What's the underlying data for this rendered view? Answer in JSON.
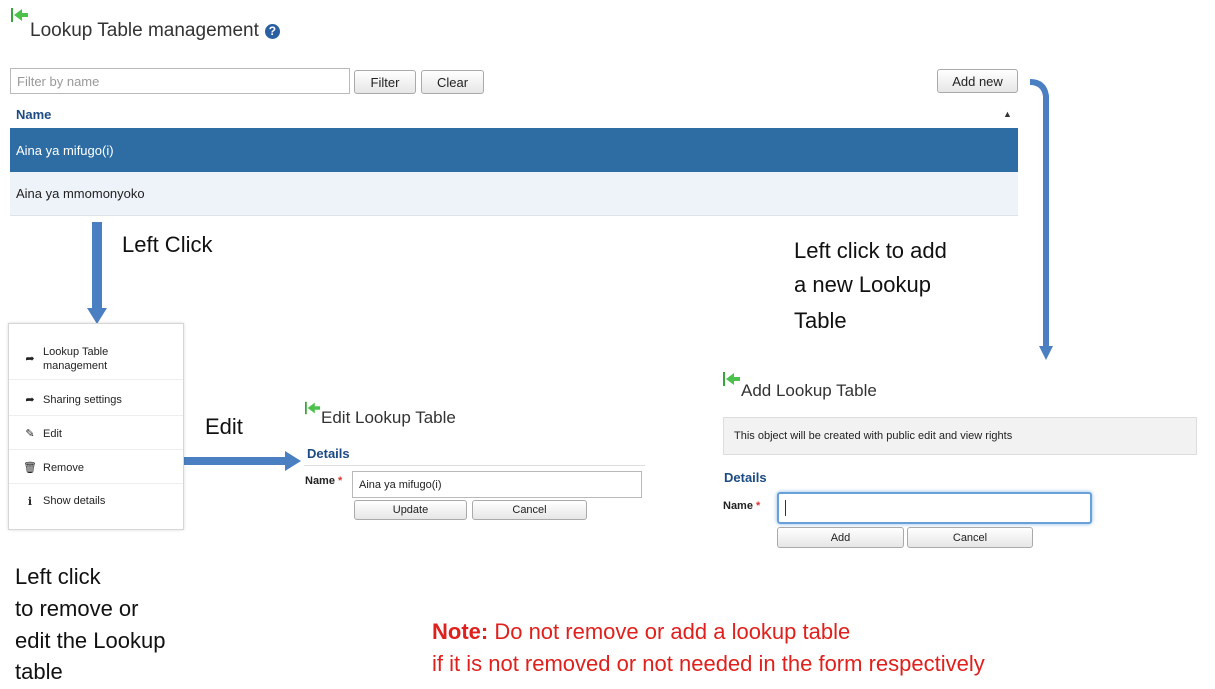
{
  "header": {
    "title": "Lookup Table management",
    "help_icon": "question-circle-icon"
  },
  "filter": {
    "placeholder": "Filter by name",
    "filter_label": "Filter",
    "clear_label": "Clear"
  },
  "add_new_label": "Add new",
  "table": {
    "column": "Name",
    "sort_indicator": "▲",
    "rows": [
      {
        "name": "Aina ya mifugo(i)",
        "selected": true
      },
      {
        "name": "Aina ya mmomonyoko",
        "selected": false
      }
    ]
  },
  "annotations": {
    "left_click": "Left Click",
    "left_click_add": [
      "Left click to add",
      "a new Lookup",
      "Table"
    ],
    "edit": "Edit",
    "left_click_remove": [
      "Left click",
      "to remove or",
      "edit the Lookup",
      "table"
    ],
    "note_label": "Note:",
    "note_line1": " Do not remove or add a lookup table",
    "note_line2": "if it is not removed or  not needed in the form respectively"
  },
  "context_menu": {
    "items": [
      {
        "icon": "share-arrow-icon",
        "glyph": "➦",
        "label_line1": "Lookup Table",
        "label_line2": "management"
      },
      {
        "icon": "share-arrow-icon",
        "glyph": "➦",
        "label_line1": "Sharing settings",
        "label_line2": ""
      },
      {
        "icon": "edit-icon",
        "glyph": "✎",
        "label_line1": "Edit",
        "label_line2": ""
      },
      {
        "icon": "trash-icon",
        "glyph": "🗑",
        "label_line1": "Remove",
        "label_line2": ""
      },
      {
        "icon": "info-icon",
        "glyph": "ℹ",
        "label_line1": "Show details",
        "label_line2": ""
      }
    ]
  },
  "edit_panel": {
    "title": "Edit Lookup Table",
    "details": "Details",
    "name_label": "Name",
    "required_mark": "*",
    "name_value": "Aina ya mifugo(i)",
    "update_label": "Update",
    "cancel_label": "Cancel"
  },
  "add_panel": {
    "title": "Add Lookup Table",
    "info": "This object will be created with public edit and view rights",
    "details": "Details",
    "name_label": "Name",
    "required_mark": "*",
    "name_value": "",
    "add_label": "Add",
    "cancel_label": "Cancel"
  },
  "colors": {
    "accent": "#2e6da4",
    "arrow": "#4a7fc2",
    "note": "#e0201c",
    "back_icon": "#3aa33a"
  }
}
